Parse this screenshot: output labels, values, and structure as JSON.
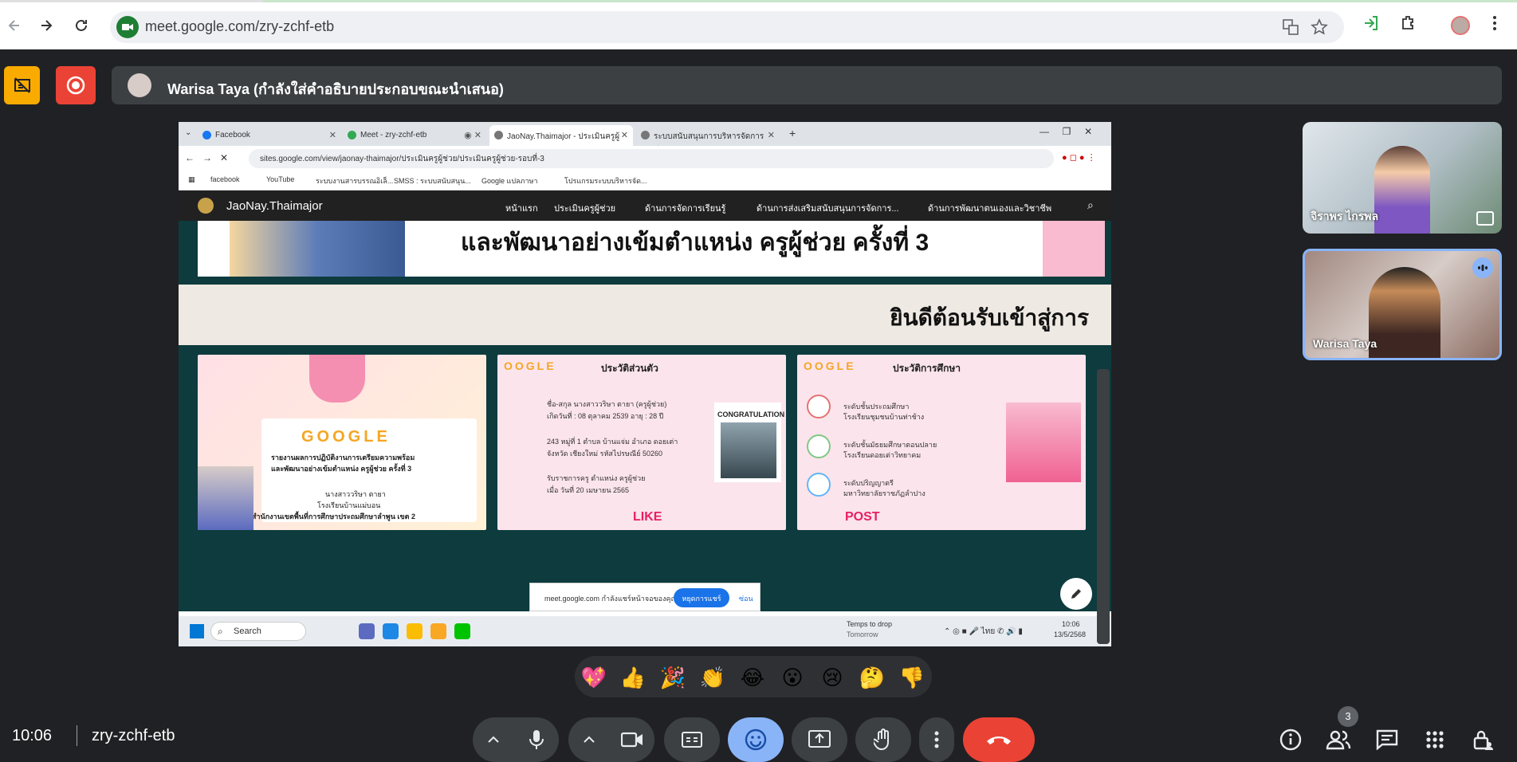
{
  "browser": {
    "url": "meet.google.com/zry-zchf-etb"
  },
  "meet": {
    "presenter_banner": "Warisa Taya (กำลังใส่คำอธิบายประกอบขณะนำเสนอ)",
    "clock": "10:06",
    "meeting_code": "zry-zchf-etb",
    "people_count": "3",
    "participants": [
      {
        "name": "จิราพร ไกรพล"
      },
      {
        "name": "Warisa Taya"
      }
    ],
    "reactions": [
      "💖",
      "👍",
      "🎉",
      "👏",
      "😂",
      "😮",
      "😢",
      "🤔",
      "👎"
    ]
  },
  "shared": {
    "tabs": [
      {
        "label": "Facebook"
      },
      {
        "label": "Meet - zry-zchf-etb"
      },
      {
        "label": "JaoNay.Thaimajor - ประเมินครูผู้"
      },
      {
        "label": "ระบบสนับสนุนการบริหารจัดการสถาน"
      }
    ],
    "url": "sites.google.com/view/jaonay-thaimajor/ประเมินครูผู้ช่วย/ประเมินครูผู้ช่วย-รอบที่-3",
    "bookmarks": [
      "facebook",
      "YouTube",
      "ระบบงานสารบรรณอิเล็...",
      "SMSS : ระบบสนับสนุน...",
      "Google แปลภาษา",
      "โปรแกรมระบบบริหารจัด..."
    ],
    "site_name": "JaoNay.Thaimajor",
    "nav": [
      "หน้าแรก",
      "ประเมินครูผู้ช่วย",
      "ด้านการจัดการเรียนรู้",
      "ด้านการส่งเสริมสนับสนุนการจัดการ...",
      "ด้านการพัฒนาตนเองและวิชาชีพ"
    ],
    "banner": "และพัฒนาอย่างเข้มตำแหน่ง ครูผู้ช่วย ครั้งที่ 3",
    "welcome": "ยินดีต้อนรับเข้าสู่การ",
    "card1": {
      "google": "GOOGLE",
      "line1": "รายงานผลการปฏิบัติงานการเตรียมความพร้อม",
      "line2": "และพัฒนาอย่างเข้มตำแหน่ง ครูผู้ช่วย ครั้งที่ 3",
      "line3": "นางสาววริษา ตายา",
      "line4": "โรงเรียนบ้านแม่บอน",
      "line5": "สำนักงานเขตพื้นที่การศึกษาประถมศึกษาลำพูน เขต 2"
    },
    "card2": {
      "title": "ประวัติส่วนตัว",
      "line1": "ชื่อ-สกุล นางสาววริษา ตายา (ครูผู้ช่วย)",
      "line2": "เกิดวันที่ : 08 ตุลาคม 2539 อายุ : 28 ปี",
      "line3": "243 หมู่ที่ 1 ตำบล บ้านแจ่ม อำเภอ ดอยเต่า",
      "line4": "จังหวัด เชียงใหม่ รหัสไปรษณีย์ 50260",
      "line5": "รับราชการครู ตำแหน่ง ครูผู้ช่วย",
      "line6": "เมื่อ วันที่ 20 เมษายน 2565",
      "badge": "CONGRATULATION",
      "like": "LIKE"
    },
    "card3": {
      "title": "ประวัติการศึกษา",
      "line1": "ระดับชั้นประถมศึกษา",
      "line2": "โรงเรียนชุมชนบ้านท่าช้าง",
      "line3": "ระดับชั้นมัธยมศึกษาตอนปลาย",
      "line4": "โรงเรียนดอยเต่าวิทยาคม",
      "line5": "ระดับปริญญาตรี",
      "line6": "มหาวิทยาลัยราชภัฏลำปาง",
      "post": "POST"
    },
    "toast": {
      "text": "meet.google.com กำลังแชร์หน้าจอของคุณ",
      "stop": "หยุดการแชร์",
      "hide": "ซ่อน"
    },
    "taskbar": {
      "search": "Search",
      "weather1": "Temps to drop",
      "weather2": "Tomorrow",
      "time": "10:06",
      "date": "13/5/2568"
    }
  },
  "colors": {
    "meet_bg": "#202124",
    "control_bg": "#3c4043",
    "hangup": "#ea4335",
    "emoji_active": "#8ab4f8"
  }
}
